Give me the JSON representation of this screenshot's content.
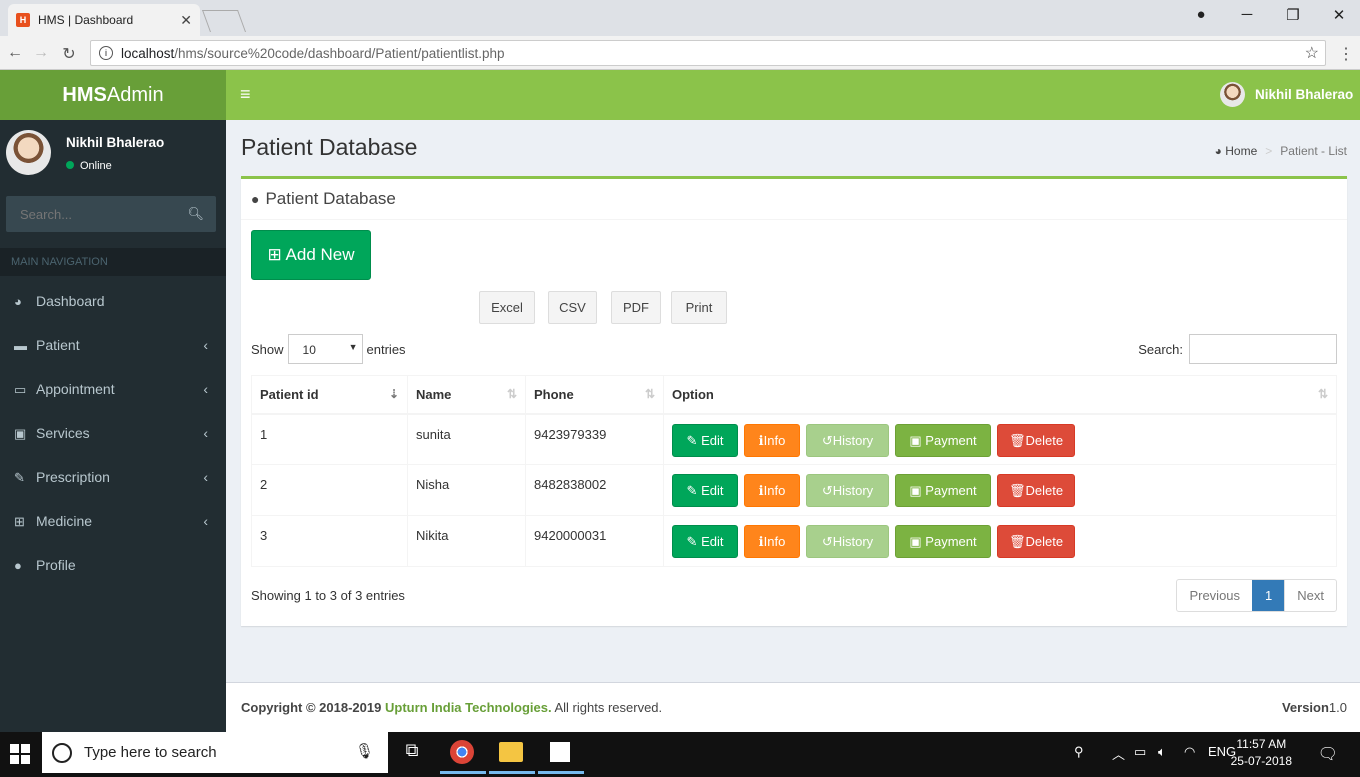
{
  "browser": {
    "tab_title": "HMS | Dashboard",
    "url_host": "localhost",
    "url_path": "/hms/source%20code/dashboard/Patient/patientlist.php"
  },
  "app": {
    "logo_bold": "HMS",
    "logo_rest": "Admin",
    "user_name": "Nikhil Bhalerao",
    "user_status": "Online",
    "search_placeholder": "Search...",
    "main_nav_label": "MAIN NAVIGATION"
  },
  "sidebar": {
    "items": [
      {
        "label": "Dashboard",
        "icon": "dashboard-icon"
      },
      {
        "label": "Patient",
        "icon": "bed-icon"
      },
      {
        "label": "Appointment",
        "icon": "laptop-icon"
      },
      {
        "label": "Services",
        "icon": "briefcase-icon"
      },
      {
        "label": "Prescription",
        "icon": "edit-icon"
      },
      {
        "label": "Medicine",
        "icon": "medkit-icon"
      },
      {
        "label": "Profile",
        "icon": "user-icon"
      }
    ]
  },
  "page": {
    "title": "Patient Database",
    "breadcrumb_home": "Home",
    "breadcrumb_current": "Patient - List",
    "box_title": "Patient Database",
    "add_new": "Add New",
    "export": [
      "Excel",
      "CSV",
      "PDF",
      "Print"
    ],
    "show_label": "Show",
    "show_value": "10",
    "entries_label": "entries",
    "search_label": "Search:",
    "columns": [
      "Patient id",
      "Name",
      "Phone",
      "Option"
    ],
    "rows": [
      {
        "id": "1",
        "name": "sunita",
        "phone": "9423979339"
      },
      {
        "id": "2",
        "name": "Nisha",
        "phone": "8482838002"
      },
      {
        "id": "3",
        "name": "Nikita",
        "phone": "9420000031"
      }
    ],
    "actions": {
      "edit": "Edit",
      "info": "Info",
      "history": "History",
      "payment": "Payment",
      "delete": "Delete"
    },
    "showing": "Showing 1 to 3 of 3 entries",
    "pager": {
      "prev": "Previous",
      "current": "1",
      "next": "Next"
    }
  },
  "footer": {
    "copyright_prefix": "Copyright © 2018-2019",
    "brand": "Upturn India Technologies.",
    "rights": "All rights reserved.",
    "version_label": "Version",
    "version_value": "1.0"
  },
  "taskbar": {
    "search_placeholder": "Type here to search",
    "language": "ENG",
    "time": "11:57 AM",
    "date": "25-07-2018"
  },
  "colors": {
    "brand_green": "#8bc34a",
    "logo_green": "#689f38",
    "sidebar_bg": "#222d32",
    "edit": "#00a65a",
    "info": "#ff851b",
    "history": "#a8d08d",
    "payment": "#7cb342",
    "delete": "#dd4b39"
  }
}
